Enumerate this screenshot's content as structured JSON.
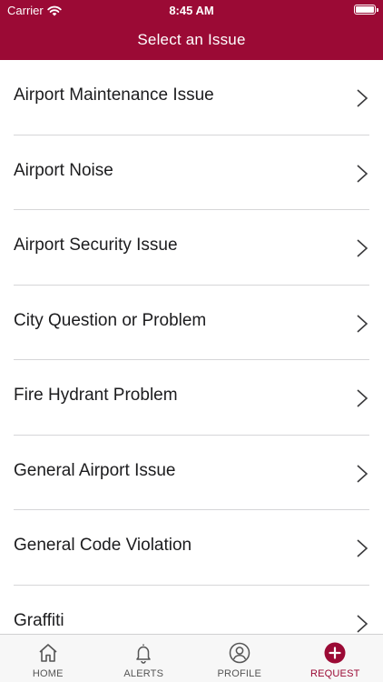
{
  "status_bar": {
    "carrier": "Carrier",
    "time": "8:45 AM"
  },
  "header": {
    "title": "Select an Issue"
  },
  "issues": [
    {
      "label": "Airport Maintenance Issue"
    },
    {
      "label": "Airport Noise"
    },
    {
      "label": "Airport Security Issue"
    },
    {
      "label": "City Question or Problem"
    },
    {
      "label": "Fire Hydrant Problem"
    },
    {
      "label": "General Airport Issue"
    },
    {
      "label": "General Code Violation"
    },
    {
      "label": "Graffiti"
    }
  ],
  "tab_bar": {
    "tabs": [
      {
        "label": "HOME",
        "icon": "home-icon"
      },
      {
        "label": "ALERTS",
        "icon": "bell-icon"
      },
      {
        "label": "PROFILE",
        "icon": "profile-icon"
      },
      {
        "label": "REQUEST",
        "icon": "plus-circle-icon",
        "active": true
      }
    ]
  },
  "colors": {
    "brand": "#9b0a35",
    "separator": "#d6d6d8"
  }
}
